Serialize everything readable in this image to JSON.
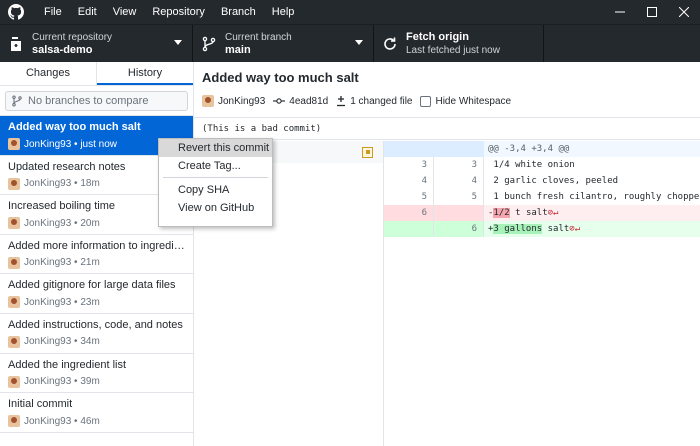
{
  "menu": {
    "items": [
      "File",
      "Edit",
      "View",
      "Repository",
      "Branch",
      "Help"
    ]
  },
  "toolbar": {
    "repo_label": "Current repository",
    "repo_value": "salsa-demo",
    "branch_label": "Current branch",
    "branch_value": "main",
    "fetch_title": "Fetch origin",
    "fetch_sub": "Last fetched just now"
  },
  "sidebar": {
    "tabs": [
      "Changes",
      "History"
    ],
    "branch_filter_placeholder": "No branches to compare",
    "commits": [
      {
        "title": "Added way too much salt",
        "meta": "JonKing93 • just now"
      },
      {
        "title": "Updated research notes",
        "meta": "JonKing93 • 18m"
      },
      {
        "title": "Increased boiling time",
        "meta": "JonKing93 • 20m"
      },
      {
        "title": "Added more information to ingredient...",
        "meta": "JonKing93 • 21m"
      },
      {
        "title": "Added gitignore for large data files",
        "meta": "JonKing93 • 23m"
      },
      {
        "title": "Added instructions, code, and notes",
        "meta": "JonKing93 • 34m"
      },
      {
        "title": "Added the ingredient list",
        "meta": "JonKing93 • 39m"
      },
      {
        "title": "Initial commit",
        "meta": "JonKing93 • 46m"
      }
    ]
  },
  "commit_detail": {
    "title": "Added way too much salt",
    "author": "JonKing93",
    "sha": "4ead81d",
    "changed_files": "1 changed file",
    "hide_whitespace": "Hide Whitespace",
    "description": "(This is a bad commit)"
  },
  "diff": {
    "hunk": "@@ -3,4 +3,4 @@",
    "lines": [
      {
        "old": "3",
        "new": "3",
        "text": " 1/4 white onion"
      },
      {
        "old": "4",
        "new": "4",
        "text": " 2 garlic cloves, peeled"
      },
      {
        "old": "5",
        "new": "5",
        "text": " 1 bunch fresh cilantro, roughly chopped"
      }
    ],
    "del_old": "6",
    "del_prefix": "-",
    "del_highlight": "1/2",
    "del_rest": " t salt",
    "add_new": "6",
    "add_prefix": "+",
    "add_highlight": "3 gallons",
    "add_rest": " salt",
    "nl_glyph": "⊘↵"
  },
  "context_menu": {
    "items": [
      "Revert this commit",
      "Create Tag...",
      "Copy SHA",
      "View on GitHub"
    ]
  }
}
